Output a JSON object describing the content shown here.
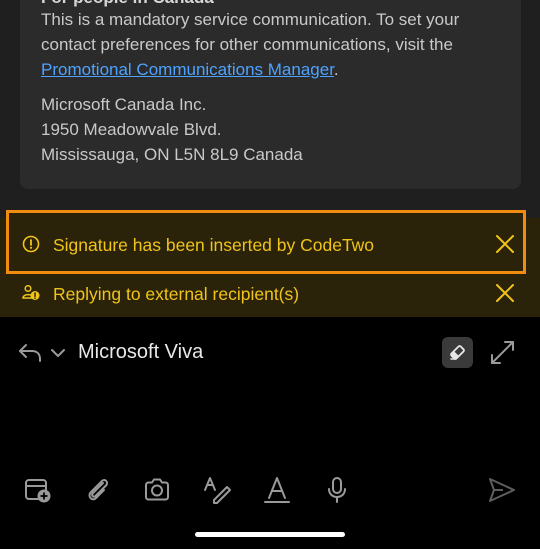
{
  "mail": {
    "heading_partial": "For people in Canada",
    "line1": "This is a mandatory service communication. To set your",
    "line2": "contact preferences for other communications, visit the",
    "link_text": "Promotional Communications Manager",
    "link_suffix": ".",
    "address_company": "Microsoft Canada Inc.",
    "address_street": "1950 Meadowvale Blvd.",
    "address_city": "Mississauga, ON L5N 8L9 Canada"
  },
  "notifications": [
    {
      "text": "Signature has been inserted by CodeTwo",
      "icon": "info-icon",
      "highlighted": true
    },
    {
      "text": "Replying to external recipient(s)",
      "icon": "external-people-icon",
      "highlighted": false
    }
  ],
  "compose": {
    "recipient": "Microsoft Viva"
  },
  "toolbar": {
    "icons": [
      "calendar-add-icon",
      "attach-icon",
      "camera-icon",
      "format-text-icon",
      "draw-icon",
      "microphone-icon",
      "send-icon"
    ]
  },
  "colors": {
    "accent_highlight": "#f28c0f",
    "notification_text": "#f0c419",
    "link": "#4da3ff"
  }
}
